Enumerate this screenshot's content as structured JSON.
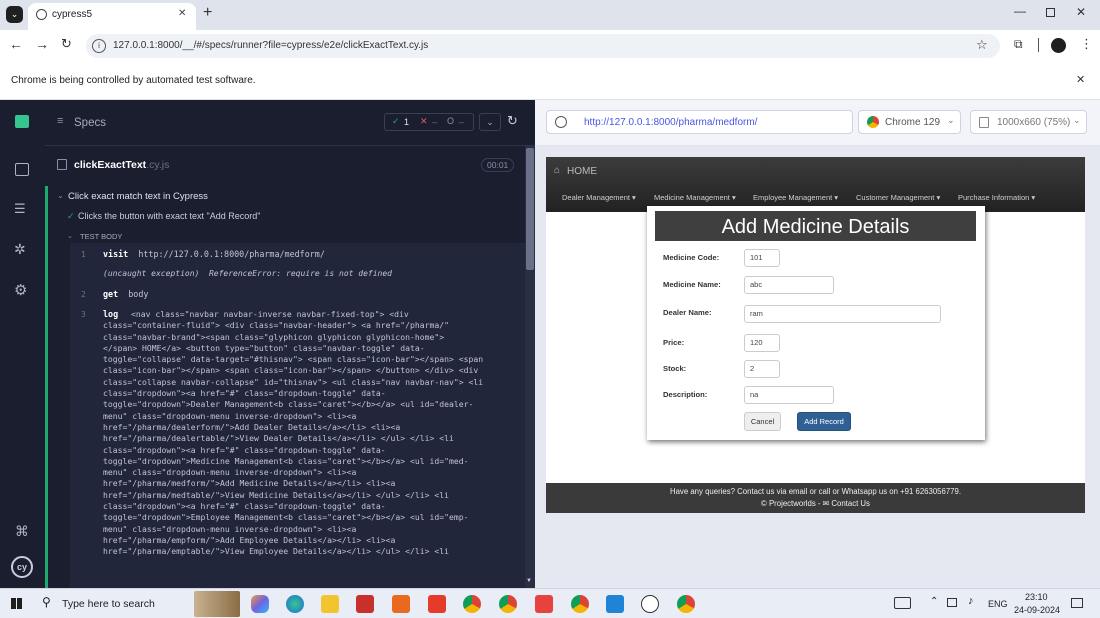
{
  "browser": {
    "tab_title": "cypress5",
    "url": "127.0.0.1:8000/__/#/specs/runner?file=cypress/e2e/clickExactText.cy.js",
    "infobar_text": "Chrome is being controlled by automated test software."
  },
  "specs_panel": {
    "title": "Specs",
    "passed_count": "1",
    "failed_symbol": "✕",
    "pending_symbol": "O",
    "spec_name": "clickExactText",
    "spec_ext": ".cy.js",
    "duration": "00:01"
  },
  "test": {
    "suite_title": "Click exact match text in Cypress",
    "test_title": "Clicks the button with exact text \"Add Record\"",
    "body_label": "TEST BODY",
    "lines": [
      {
        "num": "1",
        "cmd": "visit",
        "text": "http://127.0.0.1:8000/pharma/medform/"
      },
      {
        "num": "",
        "cmd": "",
        "text": "(uncaught exception)  ReferenceError: require is not defined"
      },
      {
        "num": "2",
        "cmd": "get",
        "text": "body"
      },
      {
        "num": "3",
        "cmd": "log",
        "text": "<nav class=\"navbar navbar-inverse navbar-fixed-top\"> <div\nclass=\"container-fluid\"> <div class=\"navbar-header\"> <a href=\"/pharma/\"\nclass=\"navbar-brand\"><span class=\"glyphicon glyphicon glyphicon-home\">\n</span> HOME</a> <button type=\"button\" class=\"navbar-toggle\" data-\ntoggle=\"collapse\" data-target=\"#thisnav\"> <span class=\"icon-bar\"></span> <span\nclass=\"icon-bar\"></span> <span class=\"icon-bar\"></span> </button> </div> <div\nclass=\"collapse navbar-collapse\" id=\"thisnav\"> <ul class=\"nav navbar-nav\"> <li\nclass=\"dropdown\"><a href=\"#\" class=\"dropdown-toggle\" data-\ntoggle=\"dropdown\">Dealer Management<b class=\"caret\"></b></a> <ul id=\"dealer-\nmenu\" class=\"dropdown-menu inverse-dropdown\"> <li><a\nhref=\"/pharma/dealerform/\">Add Dealer Details</a></li> <li><a\nhref=\"/pharma/dealertable/\">View Dealer Details</a></li> </ul> </li> <li\nclass=\"dropdown\"><a href=\"#\" class=\"dropdown-toggle\" data-\ntoggle=\"dropdown\">Medicine Management<b class=\"caret\"></b></a> <ul id=\"med-\nmenu\" class=\"dropdown-menu inverse-dropdown\"> <li><a\nhref=\"/pharma/medform/\">Add Medicine Details</a></li> <li><a\nhref=\"/pharma/medtable/\">View Medicine Details</a></li> </ul> </li> <li\nclass=\"dropdown\"><a href=\"#\" class=\"dropdown-toggle\" data-\ntoggle=\"dropdown\">Employee Management<b class=\"caret\"></b></a> <ul id=\"emp-\nmenu\" class=\"dropdown-menu inverse-dropdown\"> <li><a\nhref=\"/pharma/empform/\">Add Employee Details</a></li> <li><a\nhref=\"/pharma/emptable/\">View Employee Details</a></li> </ul> </li> <li"
      }
    ]
  },
  "aut": {
    "url": "http://127.0.0.1:8000/pharma/medform/",
    "browser_label": "Chrome 129",
    "viewport_label": "1000x660 (75%)"
  },
  "app": {
    "brand": "HOME",
    "menus": [
      "Dealer Management ▾",
      "Medicine Management ▾",
      "Employee Management ▾",
      "Customer Management ▾",
      "Purchase Information ▾"
    ],
    "form_title": "Add Medicine Details",
    "fields": [
      {
        "label": "Medicine Code:",
        "value": "101"
      },
      {
        "label": "Medicine Name:",
        "value": "abc"
      },
      {
        "label": "Dealer Name:",
        "value": "ram"
      },
      {
        "label": "Price:",
        "value": "120"
      },
      {
        "label": "Stock:",
        "value": "2"
      },
      {
        "label": "Description:",
        "value": "na"
      }
    ],
    "cancel_label": "Cancel",
    "add_label": "Add Record",
    "footer_line1": "Have any queries? Contact us via email or call or Whatsapp us on +91 6263056779.",
    "footer_line2": "© Projectworlds - ✉ Contact Us"
  },
  "taskbar": {
    "search_placeholder": "Type here to search",
    "language": "ENG",
    "time": "23:10",
    "date": "24-09-2024"
  },
  "colors": {
    "cypress_bg": "#1b1e2e",
    "pass_green": "#1fa971",
    "add_button": "#2e6094",
    "navbar": "#222222"
  }
}
